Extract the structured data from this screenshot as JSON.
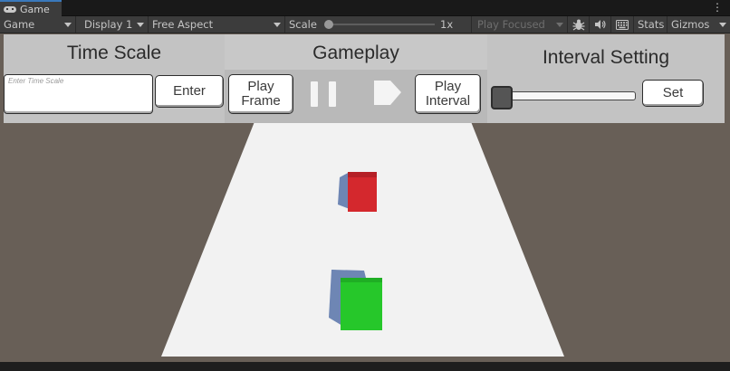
{
  "window": {
    "tab_title": "Game",
    "tab_icon": "gamepad-icon",
    "more_icon": "kebab-menu-icon"
  },
  "toolbar": {
    "view_mode": "Game",
    "display": "Display 1",
    "aspect": "Free Aspect",
    "scale_label": "Scale",
    "scale_value": "1x",
    "play_mode": "Play Focused",
    "icons": [
      "bug-icon",
      "speaker-icon",
      "keyboard-icon"
    ],
    "stats_label": "Stats",
    "gizmos_label": "Gizmos"
  },
  "ui": {
    "time_scale": {
      "title": "Time Scale",
      "input_placeholder": "Enter Time Scale",
      "enter_label": "Enter"
    },
    "gameplay": {
      "title": "Gameplay",
      "play_frame_label": "Play\nFrame",
      "pause_icon": "pause-icon",
      "play_icon": "play-icon",
      "play_interval_label": "Play\nInterval"
    },
    "interval": {
      "title": "Interval Setting",
      "slider_value": 0,
      "set_label": "Set"
    }
  },
  "scene": {
    "ground_color": "#685f57",
    "track_color": "#f2f2f2",
    "cubes": [
      {
        "name": "red-cube",
        "color": "#d4282d"
      },
      {
        "name": "green-cube",
        "color": "#26c72a"
      }
    ]
  },
  "colors": {
    "editor_bg": "#3c3c3c",
    "tab_accent": "#3a79bb",
    "panel_bg": "#c3c3c3"
  }
}
